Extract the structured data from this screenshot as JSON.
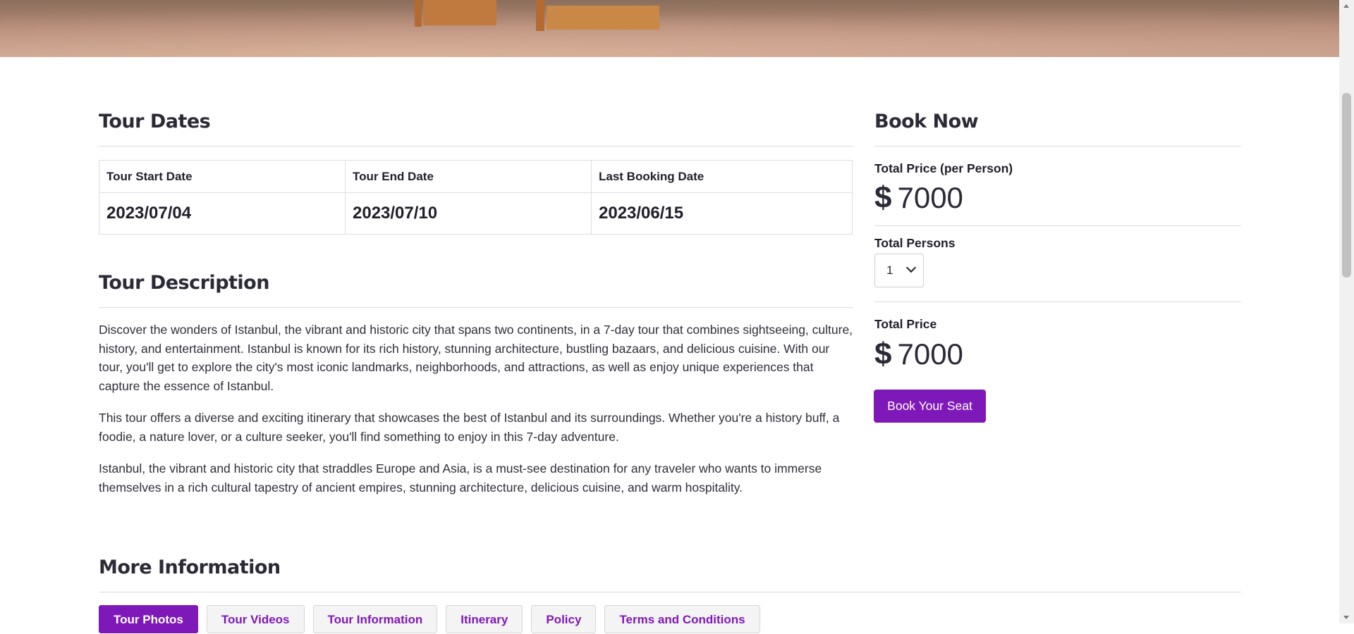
{
  "colors": {
    "accent": "#7f18b8",
    "highlight_date": "#4ccc4c",
    "heading": "#2b2b38"
  },
  "tour_dates": {
    "heading": "Tour Dates",
    "headers": [
      "Tour Start Date",
      "Tour End Date",
      "Last Booking Date"
    ],
    "values": [
      "2023/07/04",
      "2023/07/10",
      "2023/06/15"
    ]
  },
  "tour_description": {
    "heading": "Tour Description",
    "paragraphs": [
      "Discover the wonders of Istanbul, the vibrant and historic city that spans two continents, in a 7-day tour that combines sightseeing, culture, history, and entertainment. Istanbul is known for its rich history, stunning architecture, bustling bazaars, and delicious cuisine. With our tour, you'll get to explore the city's most iconic landmarks, neighborhoods, and attractions, as well as enjoy unique experiences that capture the essence of Istanbul.",
      "This tour offers a diverse and exciting itinerary that showcases the best of Istanbul and its surroundings. Whether you're a history buff, a foodie, a nature lover, or a culture seeker, you'll find something to enjoy in this 7-day adventure.",
      "Istanbul, the vibrant and historic city that straddles Europe and Asia, is a must-see destination for any traveler who wants to immerse themselves in a rich cultural tapestry of ancient empires, stunning architecture, delicious cuisine, and warm hospitality."
    ]
  },
  "book_now": {
    "heading": "Book Now",
    "price_per_person_label": "Total Price (per Person)",
    "currency_symbol": "$",
    "price_per_person": "7000",
    "persons_label": "Total Persons",
    "persons_selected": "1",
    "total_price_label": "Total Price",
    "total_price": "7000",
    "button_label": "Book Your Seat"
  },
  "more_information": {
    "heading": "More Information",
    "tabs": [
      "Tour Photos",
      "Tour Videos",
      "Tour Information",
      "Itinerary",
      "Policy",
      "Terms and Conditions"
    ],
    "active_tab": "Tour Photos"
  }
}
